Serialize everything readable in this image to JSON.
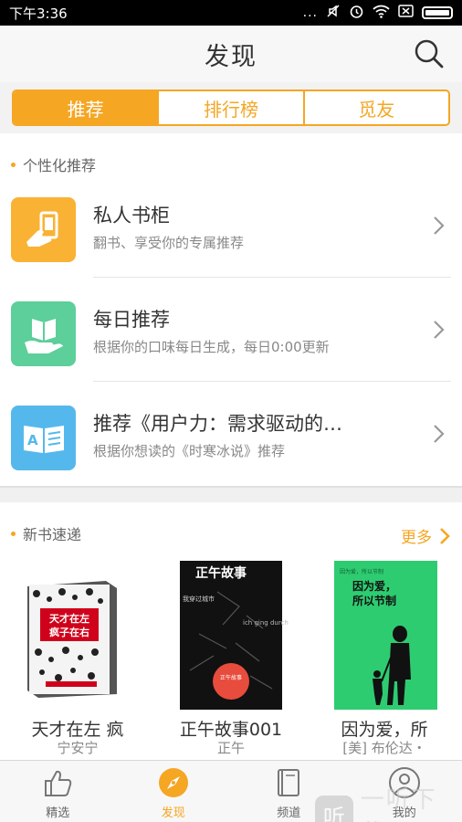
{
  "status_bar": {
    "time": "下午3:36",
    "dots": "..."
  },
  "header": {
    "title": "发现"
  },
  "tabs": [
    {
      "label": "推荐",
      "active": true
    },
    {
      "label": "排行榜",
      "active": false
    },
    {
      "label": "觅友",
      "active": false
    }
  ],
  "personal": {
    "section_title": "个性化推荐",
    "items": [
      {
        "title": "私人书柜",
        "subtitle": "翻书、享受你的专属推荐",
        "icon": "hand-phone-icon",
        "color": "#f9b233"
      },
      {
        "title": "每日推荐",
        "subtitle": "根据你的口味每日生成，每日0:00更新",
        "icon": "hand-book-icon",
        "color": "#5ccf9a"
      },
      {
        "title": "推荐《用户力：需求驱动的…",
        "subtitle": "根据你想读的《时寒冰说》推荐",
        "icon": "open-book-icon",
        "color": "#55b8ec"
      }
    ]
  },
  "new_books": {
    "section_title": "新书速递",
    "more_label": "更多",
    "books": [
      {
        "title": "天才在左  疯",
        "author": "宁安宁",
        "cover_text": "天才在左 疯子在右"
      },
      {
        "title": "正午故事001",
        "author": "正午",
        "cover_text": "正午故事"
      },
      {
        "title": "因为爱，所",
        "author": "[美] 布伦达・",
        "cover_text": "因为爱，所以节制"
      }
    ]
  },
  "bottom_nav": [
    {
      "label": "精选",
      "icon": "thumb-up-icon",
      "active": false
    },
    {
      "label": "发现",
      "icon": "compass-icon",
      "active": true
    },
    {
      "label": "频道",
      "icon": "books-icon",
      "active": false
    },
    {
      "label": "我的",
      "icon": "user-icon",
      "active": false
    }
  ],
  "watermark": {
    "badge": "听",
    "text": "一听下载"
  },
  "colors": {
    "accent": "#f5a623",
    "text": "#333333",
    "muted": "#888888"
  }
}
